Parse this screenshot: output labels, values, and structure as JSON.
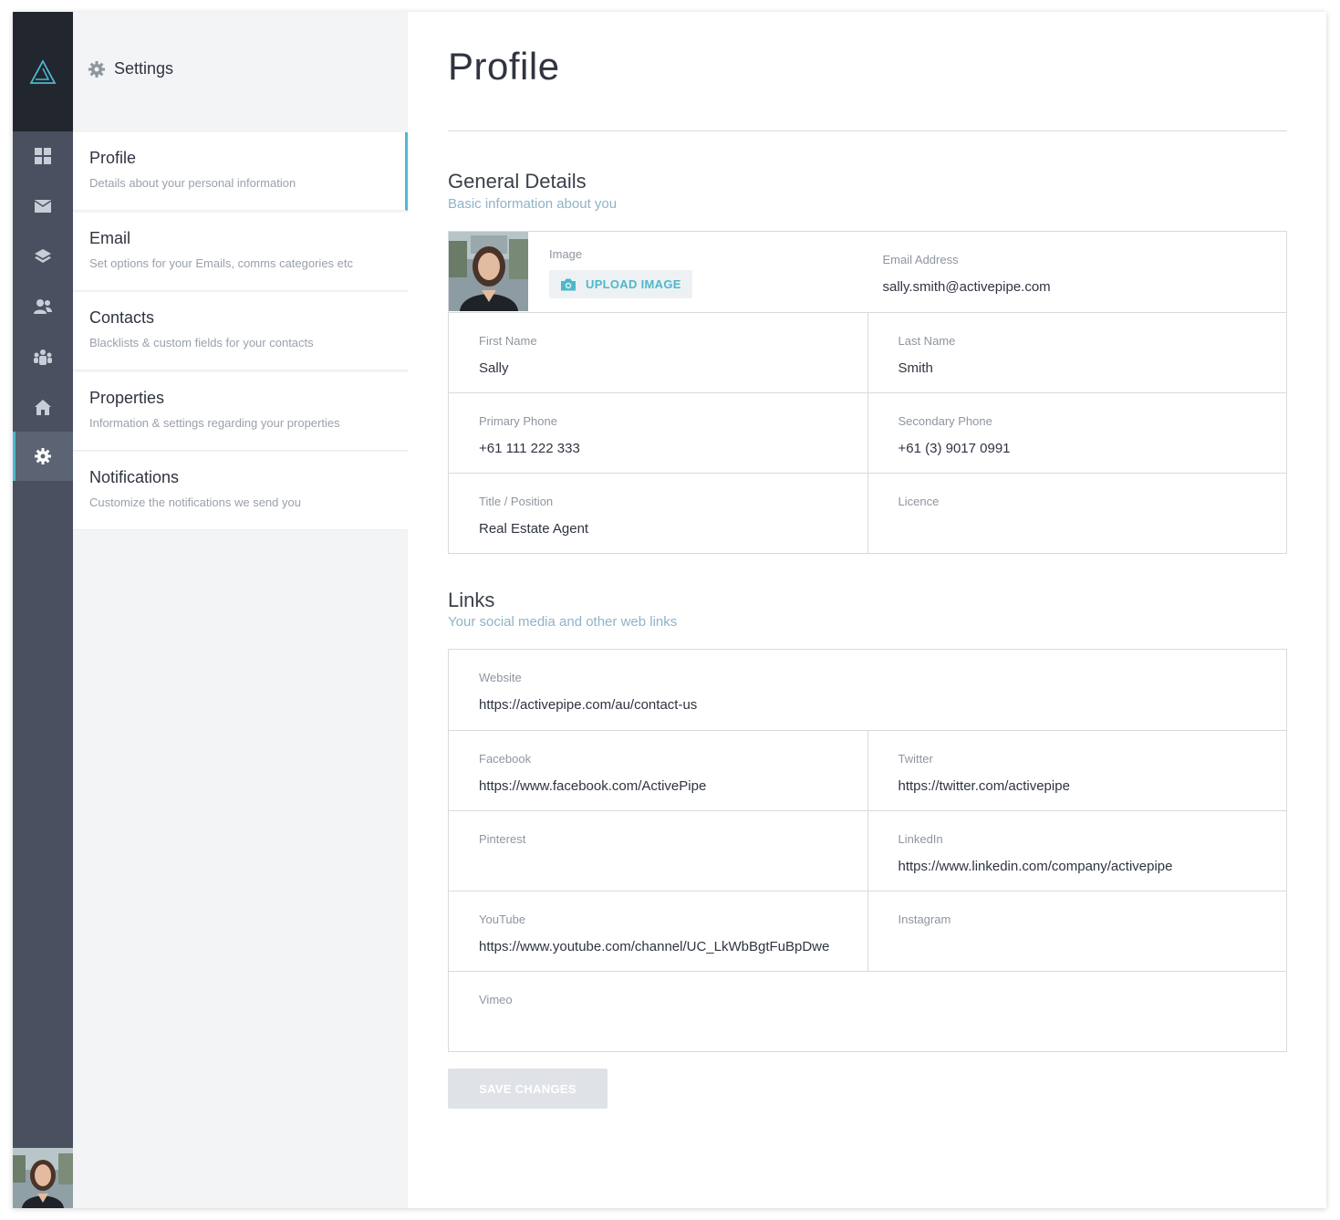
{
  "sidebar": {
    "settings_title": "Settings",
    "items": [
      {
        "title": "Profile",
        "desc": "Details about your personal information"
      },
      {
        "title": "Email",
        "desc": "Set options for your Emails, comms categories etc"
      },
      {
        "title": "Contacts",
        "desc": "Blacklists & custom fields for your contacts"
      },
      {
        "title": "Properties",
        "desc": "Information & settings regarding your properties"
      },
      {
        "title": "Notifications",
        "desc": "Customize the notifications we send you"
      }
    ]
  },
  "rail_icons": [
    "logo-icon",
    "dashboard-icon",
    "mail-icon",
    "layers-icon",
    "contacts-icon",
    "groups-icon",
    "home-icon",
    "gear-icon"
  ],
  "page": {
    "title": "Profile"
  },
  "general": {
    "title": "General Details",
    "subtitle": "Basic information about you",
    "image_label": "Image",
    "upload_label": "UPLOAD IMAGE",
    "email_label": "Email Address",
    "email": "sally.smith@activepipe.com",
    "first_name_label": "First Name",
    "first_name": "Sally",
    "last_name_label": "Last Name",
    "last_name": "Smith",
    "primary_phone_label": "Primary Phone",
    "primary_phone": "+61 111 222 333",
    "secondary_phone_label": "Secondary Phone",
    "secondary_phone": "+61 (3) 9017 0991",
    "position_label": "Title / Position",
    "position": "Real Estate Agent",
    "licence_label": "Licence",
    "licence": ""
  },
  "links": {
    "title": "Links",
    "subtitle": "Your social media and other web links",
    "website_label": "Website",
    "website": "https://activepipe.com/au/contact-us",
    "facebook_label": "Facebook",
    "facebook": "https://www.facebook.com/ActivePipe",
    "twitter_label": "Twitter",
    "twitter": "https://twitter.com/activepipe",
    "pinterest_label": "Pinterest",
    "pinterest": "",
    "linkedin_label": "LinkedIn",
    "linkedin": "https://www.linkedin.com/company/activepipe",
    "youtube_label": "YouTube",
    "youtube": "https://www.youtube.com/channel/UC_LkWbBgtFuBpDwe",
    "instagram_label": "Instagram",
    "instagram": "",
    "vimeo_label": "Vimeo",
    "vimeo": ""
  },
  "actions": {
    "save_label": "SAVE CHANGES"
  },
  "colors": {
    "accent": "#4db8cc",
    "rail": "#4a5060",
    "rail_top": "#22262f"
  }
}
